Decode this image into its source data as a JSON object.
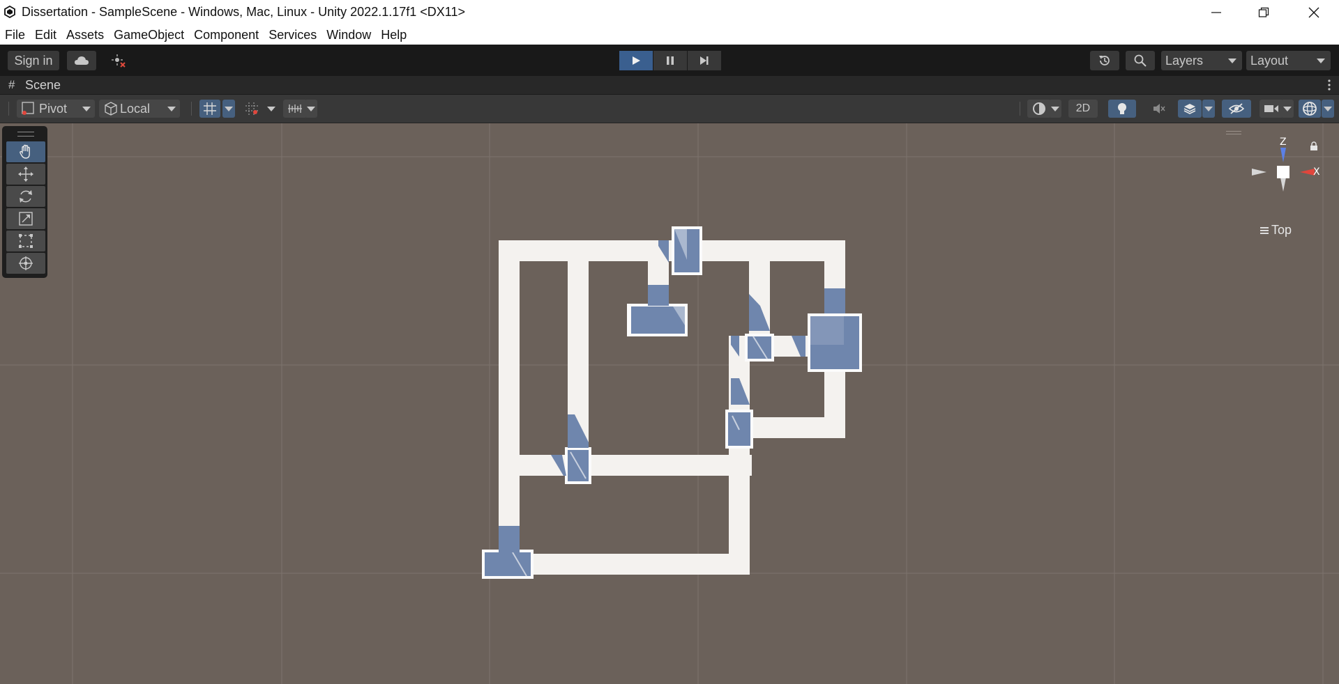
{
  "window": {
    "title": "Dissertation - SampleScene - Windows, Mac, Linux - Unity 2022.1.17f1 <DX11>",
    "controls": [
      "minimize-icon",
      "restore-icon",
      "close-icon"
    ]
  },
  "menu": {
    "items": [
      "File",
      "Edit",
      "Assets",
      "GameObject",
      "Component",
      "Services",
      "Window",
      "Help"
    ]
  },
  "toolbar": {
    "sign_in_label": "Sign in",
    "layers_label": "Layers",
    "layout_label": "Layout",
    "play_state": "playing"
  },
  "scene_tab": {
    "label": "Scene"
  },
  "scene_toolbar": {
    "pivot_label": "Pivot",
    "local_label": "Local",
    "mode_2d_label": "2D"
  },
  "scene_view": {
    "view_label": "Top",
    "gizmo_axes": {
      "z": "Z",
      "x": "X"
    },
    "colors": {
      "background": "#6b615a",
      "corridor": "#f4f2ef",
      "door": "#6f86ad",
      "axis_z": "#5b80e6",
      "axis_x": "#e0463c"
    }
  },
  "tools": {
    "items": [
      "hand-tool-icon",
      "move-tool-icon",
      "rotate-tool-icon",
      "scale-tool-icon",
      "rect-tool-icon",
      "transform-tool-icon"
    ],
    "active": "hand-tool-icon"
  }
}
